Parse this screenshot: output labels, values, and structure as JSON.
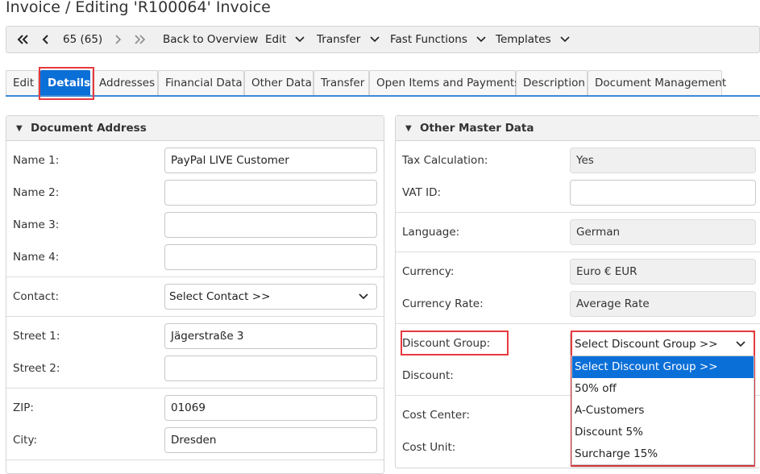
{
  "page": {
    "title": "Invoice / Editing 'R100064' Invoice"
  },
  "toolbar": {
    "record_counter": "65 (65)",
    "back_label": "Back to Overview",
    "menus": [
      "Edit",
      "Transfer",
      "Fast Functions",
      "Templates"
    ]
  },
  "tabs": [
    "Edit",
    "Details",
    "Addresses",
    "Financial Data",
    "Other Data",
    "Transfer",
    "Open Items and Payments",
    "Description",
    "Document Management"
  ],
  "active_tab": "Details",
  "document_address": {
    "title": "Document Address",
    "fields": [
      {
        "label": "Name 1:",
        "value": "PayPal LIVE Customer"
      },
      {
        "label": "Name 2:",
        "value": ""
      },
      {
        "label": "Name 3:",
        "value": ""
      },
      {
        "label": "Name 4:",
        "value": ""
      },
      {
        "label": "Contact:",
        "value": "Select Contact >>"
      },
      {
        "label": "Street 1:",
        "value": "Jägerstraße 3"
      },
      {
        "label": "Street 2:",
        "value": ""
      },
      {
        "label": "ZIP:",
        "value": "01069"
      },
      {
        "label": "City:",
        "value": "Dresden"
      }
    ]
  },
  "other_master_data": {
    "title": "Other Master Data",
    "fields": [
      {
        "label": "Tax Calculation:",
        "value": "Yes"
      },
      {
        "label": "VAT ID:",
        "value": ""
      },
      {
        "label": "Language:",
        "value": "German"
      },
      {
        "label": "Currency:",
        "value": "Euro € EUR"
      },
      {
        "label": "Currency Rate:",
        "value": "Average Rate"
      },
      {
        "label": "Discount Group:",
        "value": "Select Discount Group >>"
      },
      {
        "label": "Discount:",
        "value": ""
      },
      {
        "label": "Cost Center:",
        "value": ""
      },
      {
        "label": "Cost Unit:",
        "value": ""
      }
    ]
  },
  "discount_group_dropdown": {
    "options": [
      "Select Discount Group >>",
      "50% off",
      "A-Customers",
      "Discount 5%",
      "Surcharge 15%"
    ],
    "selected": "Select Discount Group >>"
  },
  "colors": {
    "accent": "#0b6fd8",
    "highlight": "#e63a3f",
    "tab_underline": "#3b8ad6"
  }
}
